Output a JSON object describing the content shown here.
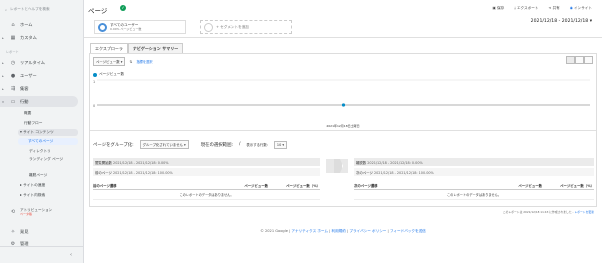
{
  "search": {
    "placeholder": "レポートとヘルプを検索"
  },
  "sidebar": {
    "top": [
      {
        "label": "ホーム"
      },
      {
        "label": "カスタム"
      }
    ],
    "reports_heading": "レポート",
    "items": [
      {
        "label": "リアルタイム"
      },
      {
        "label": "ユーザー"
      },
      {
        "label": "集客"
      },
      {
        "label": "行動"
      }
    ],
    "behavior": {
      "overview": "概要",
      "flow": "行動フロー",
      "site_content": "サイト コンテンツ",
      "all_pages": "すべてのページ",
      "drilldown": "ディレクトリ",
      "landing": "ランディング ページ",
      "exit": "離脱ページ",
      "speed": "サイトの速度",
      "search": "サイト内検索"
    },
    "attribution": {
      "label": "アトリビューション",
      "beta": "ベータ版"
    },
    "discover": "発見",
    "admin": "管理"
  },
  "header": {
    "title": "ページ",
    "save": "保存",
    "export": "エクスポート",
    "share": "共有",
    "insights": "インサイト",
    "segment": {
      "name": "すべてのユーザー",
      "sub": "0.00% ページビュー数"
    },
    "add_segment": "+ セグメントを追加",
    "date_range": "2021/12/18 - 2021/12/18"
  },
  "tabs": [
    "エクスプローラ",
    "ナビゲーション サマリー"
  ],
  "chart": {
    "metric_select": "ページビュー数",
    "compare": "指標を選択",
    "legend": "ページビュー数",
    "y_top": "1",
    "y_zero": "0",
    "x_label": "2021年12月18日土曜日"
  },
  "chart_data": {
    "type": "line",
    "x": [
      "2021/12/18"
    ],
    "series": [
      {
        "name": "ページビュー数",
        "values": [
          0
        ]
      }
    ],
    "ylim": [
      0,
      1
    ]
  },
  "group": {
    "label": "ページをグループ化:",
    "select": "グループ化されていません",
    "current": "現在の選択範囲:",
    "current_val": "/",
    "rows_label": "表示する行数:",
    "rows_val": "10"
  },
  "stats": {
    "left_title": "閲覧開始数",
    "left_val": "2021/12/18 - 2021/12/18: 0.00%",
    "left2_title": "前のページ",
    "left2_val": "2021/12/18 - 2021/12/18: 100.00%",
    "right_title": "離脱数",
    "right_val": "2021/12/18 - 2021/12/18: 0.00%",
    "right2_title": "次のページ",
    "right2_val": "2021/12/18 - 2021/12/18: 100.00%"
  },
  "table_left": {
    "col1": "前のページ遷移",
    "col2": "ページビュー数",
    "col3": "ページビュー数（%）",
    "empty": "このレポートのデータはありません。"
  },
  "table_right": {
    "col1": "次のページ遷移",
    "col2": "ページビュー数",
    "col3": "ページビュー数（%）",
    "empty": "このレポートのデータはありません。"
  },
  "footer": {
    "note": "このレポートは 2021/12/18 11:43 に作成されました -",
    "refresh": "レポートを更新",
    "copyright": "© 2021 Google",
    "links": [
      "アナリティクス ホーム",
      "利用規約",
      "プライバシー ポリシー",
      "フィードバックを送信"
    ]
  }
}
